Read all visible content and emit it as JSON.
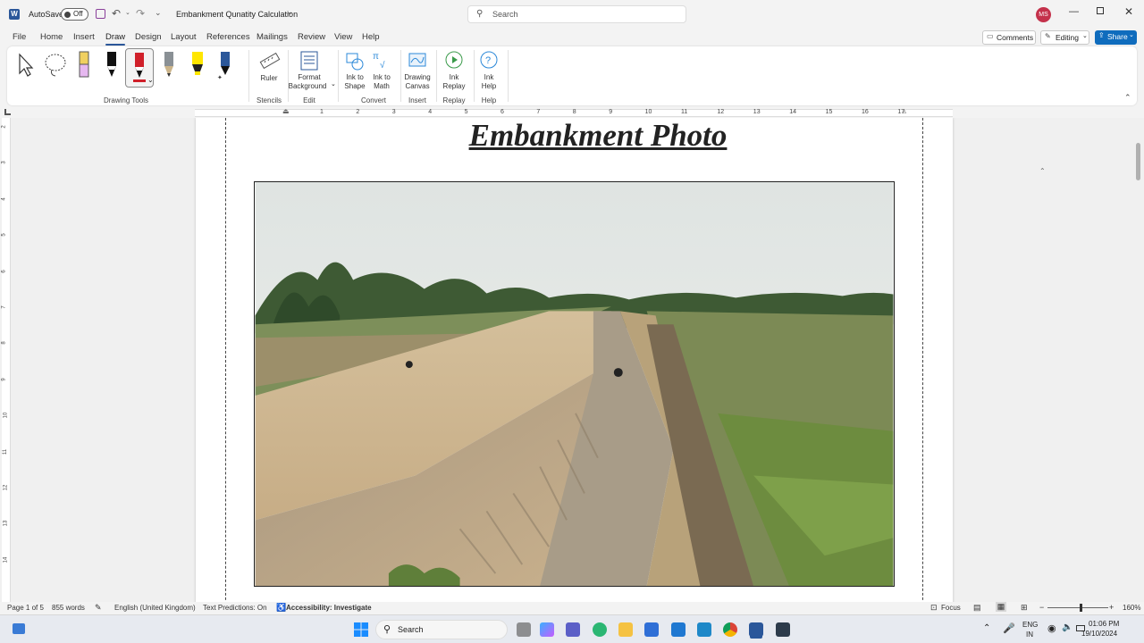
{
  "titlebar": {
    "autosave_label": "AutoSave",
    "autosave_state": "Off",
    "doc_title": "Embankment Qunatity Calculation",
    "search_placeholder": "Search",
    "avatar_initials": "MS"
  },
  "tabs": [
    "File",
    "Home",
    "Insert",
    "Draw",
    "Design",
    "Layout",
    "References",
    "Mailings",
    "Review",
    "View",
    "Help"
  ],
  "active_tab": "Draw",
  "right_buttons": {
    "comments": "Comments",
    "editing": "Editing",
    "share": "Share"
  },
  "ribbon": {
    "groups": {
      "drawing_tools": "Drawing Tools",
      "stencils": "Stencils",
      "edit": "Edit",
      "convert": "Convert",
      "insert": "Insert",
      "replay": "Replay",
      "help": "Help"
    },
    "buttons": {
      "ruler": "Ruler",
      "format_bg_1": "Format",
      "format_bg_2": "Background",
      "ink_shape_1": "Ink to",
      "ink_shape_2": "Shape",
      "ink_math_1": "Ink to",
      "ink_math_2": "Math",
      "canvas_1": "Drawing",
      "canvas_2": "Canvas",
      "replay_1": "Ink",
      "replay_2": "Replay",
      "help_1": "Ink",
      "help_2": "Help"
    }
  },
  "ruler_numbers": [
    "1",
    "2",
    "3",
    "4",
    "5",
    "6",
    "7",
    "8",
    "9",
    "10",
    "11",
    "12",
    "13",
    "14",
    "15",
    "16",
    "17"
  ],
  "vruler_numbers": [
    "2",
    "3",
    "4",
    "5",
    "6",
    "7",
    "8",
    "9",
    "10",
    "11",
    "12",
    "13",
    "14"
  ],
  "document": {
    "heading": "Embankment Photo"
  },
  "status": {
    "page": "Page 1 of 5",
    "words": "855 words",
    "language": "English (United Kingdom)",
    "predictions": "Text Predictions: On",
    "accessibility": "Accessibility: Investigate",
    "focus": "Focus",
    "zoom": "160%"
  },
  "taskbar": {
    "search_label": "Search",
    "lang_1": "ENG",
    "lang_2": "IN",
    "time": "01:06 PM",
    "date": "19/10/2024"
  },
  "colors": {
    "accent": "#2b579a",
    "share": "#0f6cbd",
    "avatar": "#c4314b"
  }
}
